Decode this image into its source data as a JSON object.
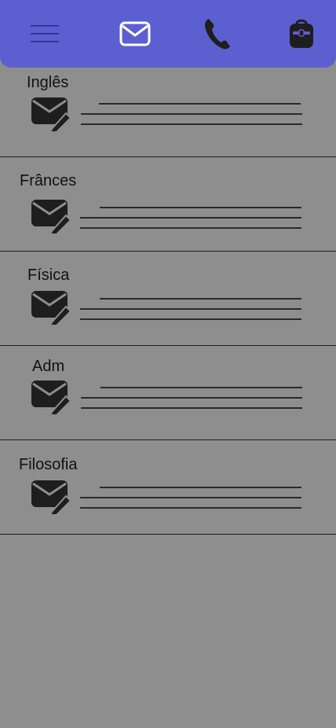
{
  "topbar": {
    "icons": [
      "menu-icon",
      "mail-icon",
      "phone-icon",
      "backpack-icon"
    ],
    "color": "#5b5fcf"
  },
  "subjects": [
    {
      "label": "Inglês"
    },
    {
      "label": "Frânces"
    },
    {
      "label": "Física"
    },
    {
      "label": "Adm"
    },
    {
      "label": "Filosofia"
    }
  ]
}
